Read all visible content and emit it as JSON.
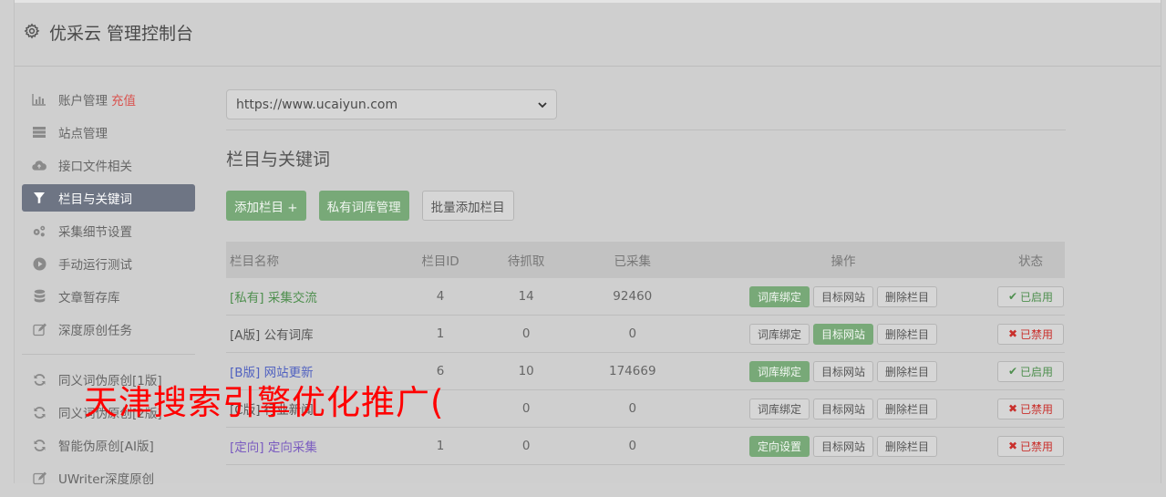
{
  "header": {
    "title": "优采云 管理控制台",
    "icon": "gear-icon"
  },
  "sidebar": {
    "items": [
      {
        "label": "账户管理",
        "extra": "充值",
        "icon": "bar-chart-icon",
        "active": false
      },
      {
        "label": "站点管理",
        "icon": "server-icon",
        "active": false
      },
      {
        "label": "接口文件相关",
        "icon": "cloud-upload-icon",
        "active": false
      },
      {
        "label": "栏目与关键词",
        "icon": "filter-icon",
        "active": true
      },
      {
        "label": "采集细节设置",
        "icon": "gears-icon",
        "active": false
      },
      {
        "label": "手动运行测试",
        "icon": "play-circle-icon",
        "active": false
      },
      {
        "label": "文章暂存库",
        "icon": "database-icon",
        "active": false
      },
      {
        "label": "深度原创任务",
        "icon": "edit-icon",
        "active": false
      }
    ],
    "items2": [
      {
        "label": "同义词伪原创[1版]",
        "icon": "refresh-icon"
      },
      {
        "label": "同义词伪原创[2版]",
        "icon": "refresh-icon"
      },
      {
        "label": "智能伪原创[AI版]",
        "icon": "refresh-icon"
      },
      {
        "label": "UWriter深度原创",
        "icon": "edit-icon"
      }
    ]
  },
  "main": {
    "site_select": "https://www.ucaiyun.com",
    "section_title": "栏目与关键词",
    "buttons": {
      "add": "添加栏目 +",
      "private_lib": "私有词库管理",
      "batch_add": "批量添加栏目"
    },
    "table": {
      "headers": [
        "栏目名称",
        "栏目ID",
        "待抓取",
        "已采集",
        "操作",
        "状态"
      ],
      "rows": [
        {
          "tag": "[私有]",
          "name": "采集交流",
          "id": "4",
          "pending": "14",
          "collected": "92460",
          "op1": "词库绑定",
          "op1_active": true,
          "op2": "目标网站",
          "op2_active": false,
          "op3": "删除栏目",
          "status": "已启用",
          "enabled": true,
          "style": "green"
        },
        {
          "tag": "[A版]",
          "name": "公有词库",
          "id": "1",
          "pending": "0",
          "collected": "0",
          "op1": "词库绑定",
          "op1_active": false,
          "op2": "目标网站",
          "op2_active": true,
          "op3": "删除栏目",
          "status": "已禁用",
          "enabled": false,
          "style": "dark"
        },
        {
          "tag": "[B版]",
          "name": "网站更新",
          "id": "6",
          "pending": "10",
          "collected": "174669",
          "op1": "词库绑定",
          "op1_active": true,
          "op2": "目标网站",
          "op2_active": false,
          "op3": "删除栏目",
          "status": "已启用",
          "enabled": true,
          "style": "blue"
        },
        {
          "tag": "[C版]",
          "name": "行业新闻",
          "id": "",
          "pending": "0",
          "collected": "0",
          "op1": "词库绑定",
          "op1_active": false,
          "op2": "目标网站",
          "op2_active": false,
          "op3": "删除栏目",
          "status": "已禁用",
          "enabled": false,
          "style": "dark"
        },
        {
          "tag": "[定向]",
          "name": "定向采集",
          "id": "1",
          "pending": "0",
          "collected": "0",
          "op1": "定向设置",
          "op1_active": true,
          "op2": "目标网站",
          "op2_active": false,
          "op3": "删除栏目",
          "status": "已禁用",
          "enabled": false,
          "style": "purple"
        }
      ]
    }
  },
  "watermark": "天津搜索引擎优化推广(",
  "colors": {
    "accent_green": "#78a978",
    "active_sidebar": "#6e7584",
    "danger": "#c9302c",
    "watermark": "#ff0000"
  }
}
